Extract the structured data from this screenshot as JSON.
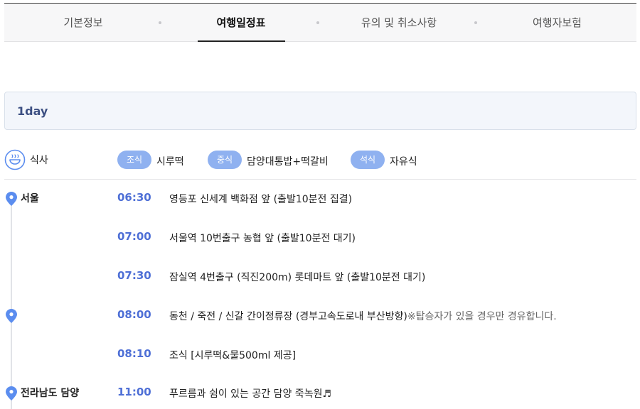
{
  "tabs": [
    {
      "label": "기본정보"
    },
    {
      "label": "여행일정표"
    },
    {
      "label": "유의 및 취소사항"
    },
    {
      "label": "여행자보험"
    }
  ],
  "day": {
    "label": "1day"
  },
  "meals": {
    "title": "식사",
    "items": [
      {
        "type": "조식",
        "menu": "시루떡"
      },
      {
        "type": "중식",
        "menu": "담양대통밥+떡갈비"
      },
      {
        "type": "석식",
        "menu": "자유식"
      }
    ]
  },
  "schedule": [
    {
      "place": "서울",
      "time": "06:30",
      "desc": "영등포 신세계 백화점 앞 (출발10분전 집결)",
      "note": ""
    },
    {
      "place": "",
      "time": "07:00",
      "desc": "서울역 10번출구 농협 앞 (출발10분전 대기)",
      "note": ""
    },
    {
      "place": "",
      "time": "07:30",
      "desc": "잠실역 4번출구 (직진200m) 롯데마트 앞 (출발10분전 대기)",
      "note": ""
    },
    {
      "place": "",
      "time": "08:00",
      "desc": "동천 / 죽전 / 신갈 간이정류장 (경부고속도로내 부산방향)",
      "note": "※탑승자가 있을 경우만 경유합니다."
    },
    {
      "place": "",
      "time": "08:10",
      "desc": "조식 [시루떡&물500ml 제공]",
      "note": ""
    },
    {
      "place": "전라남도 담양",
      "time": "11:00",
      "desc": "푸르름과 쉼이 있는 공간 담양 죽녹원♬",
      "note": ""
    }
  ],
  "colors": {
    "accent": "#4e6fd6",
    "pill": "#8fb1f0",
    "pin": "#5b8def",
    "day_text": "#3c4f82"
  }
}
